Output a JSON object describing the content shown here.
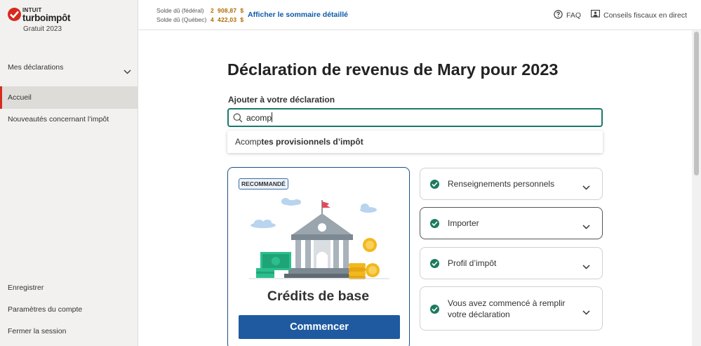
{
  "brand": {
    "intuit": "INTUIT",
    "turbo": "turboimpôt",
    "subtitle": "Gratuit 2023",
    "accent": "#d52b1e"
  },
  "sidebar": {
    "items": [
      {
        "label": "Mes déclarations",
        "icon": "chevron-down-icon"
      },
      {
        "label": "Accueil",
        "active": true
      },
      {
        "label": "Nouveautés concernant l’impôt"
      },
      {
        "label": "Enregistrer"
      },
      {
        "label": "Paramètres du compte"
      },
      {
        "label": "Fermer la session"
      }
    ]
  },
  "topbar": {
    "federal_label": "Solde dû (fédéral)",
    "federal_amount": "2  908,87  $",
    "quebec_label": "Solde dû (Québec)",
    "quebec_amount": "4  422,03  $",
    "summary_link": "Afficher le sommaire détaillé",
    "faq": "FAQ",
    "faq_icon": "question-circle-icon",
    "conseils": "Conseils fiscaux en direct",
    "conseils_icon": "monitor-person-icon"
  },
  "main": {
    "title": "Déclaration de revenus de Mary pour 2023",
    "add_label": "Ajouter à votre déclaration",
    "search": {
      "value": "acomp",
      "icon": "search-icon"
    },
    "suggestion": {
      "match": "Acomp",
      "rest": "tes provisionnels d’impôt"
    },
    "card": {
      "badge": "RECOMMANDÉ",
      "title": "Crédits de base",
      "button": "Commencer",
      "button_color": "#1f5aa0"
    },
    "accordion": [
      {
        "label": "Renseignements personnels",
        "done": true
      },
      {
        "label": "Importer",
        "done": true
      },
      {
        "label": "Profil d’impôt",
        "done": true
      },
      {
        "label_line1": "Vous avez commencé à remplir",
        "label_line2": "votre déclaration",
        "done": true
      }
    ],
    "check_color": "#1d7a5f"
  }
}
